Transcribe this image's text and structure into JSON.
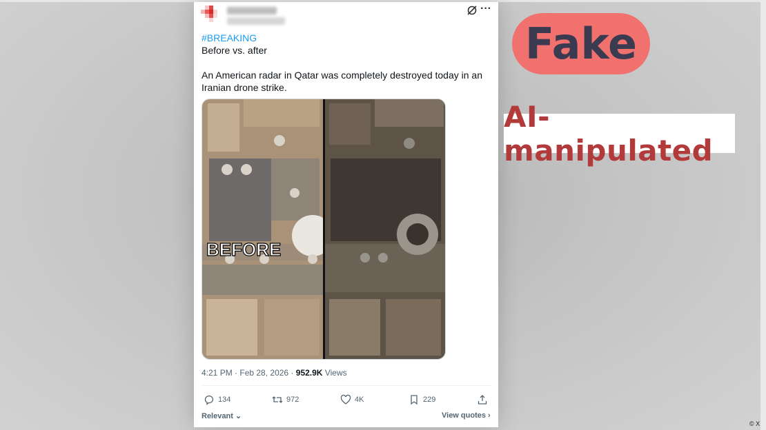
{
  "post": {
    "hashtag": "#BREAKING",
    "subtitle": "Before vs. after",
    "body": "An American radar in Qatar was completely destroyed today in an Iranian drone strike.",
    "image_label": "BEFORE",
    "time": "4:21 PM",
    "date": "Feb 28, 2026",
    "views_count": "952.9K",
    "views_label": "Views",
    "replies": "134",
    "reposts": "972",
    "likes": "4K",
    "bookmarks": "229",
    "sort_label": "Relevant",
    "view_quotes": "View quotes"
  },
  "labels": {
    "verdict": "Fake",
    "verdict_color": "#f0716d",
    "classification": "AI-manipulated",
    "classification_color": "#b23a3a"
  },
  "credit": "X",
  "icons": [
    "grok-icon",
    "more-icon",
    "reply-icon",
    "repost-icon",
    "like-icon",
    "bookmark-icon",
    "share-icon",
    "chevron-down-icon",
    "chevron-right-icon"
  ]
}
